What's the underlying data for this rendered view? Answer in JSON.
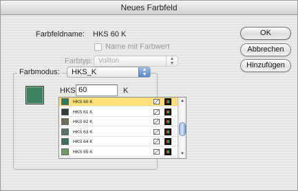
{
  "window": {
    "title": "Neues Farbfeld"
  },
  "form": {
    "name_label": "Farbfeldname:",
    "name_value": "HKS 60 K",
    "name_with_value_label": "Name mit Farbwert",
    "type_label": "Farbtyp:",
    "type_value": "Vollton",
    "mode_label": "Farbmodus:",
    "mode_value": "HKS_K",
    "hks_label": "HKS",
    "hks_input_value": "60",
    "hks_suffix": "K",
    "preview_color": "#3f7f62"
  },
  "buttons": {
    "ok": "OK",
    "cancel": "Abbrechen",
    "add": "Hinzufügen"
  },
  "swatch_list": [
    {
      "name": "HKS 60 K",
      "color": "#2f7a5a",
      "selected": true
    },
    {
      "name": "HKS 61 K",
      "color": "#2f3b38",
      "selected": false
    },
    {
      "name": "HKS 62 K",
      "color": "#6f6a5a",
      "selected": false
    },
    {
      "name": "HKS 63 K",
      "color": "#5c6f68",
      "selected": false
    },
    {
      "name": "HKS 64 K",
      "color": "#3f6f5f",
      "selected": false
    },
    {
      "name": "HKS 65 K",
      "color": "#6f9b5e",
      "selected": false
    }
  ],
  "scroll": {
    "position_fraction": 0.55
  }
}
